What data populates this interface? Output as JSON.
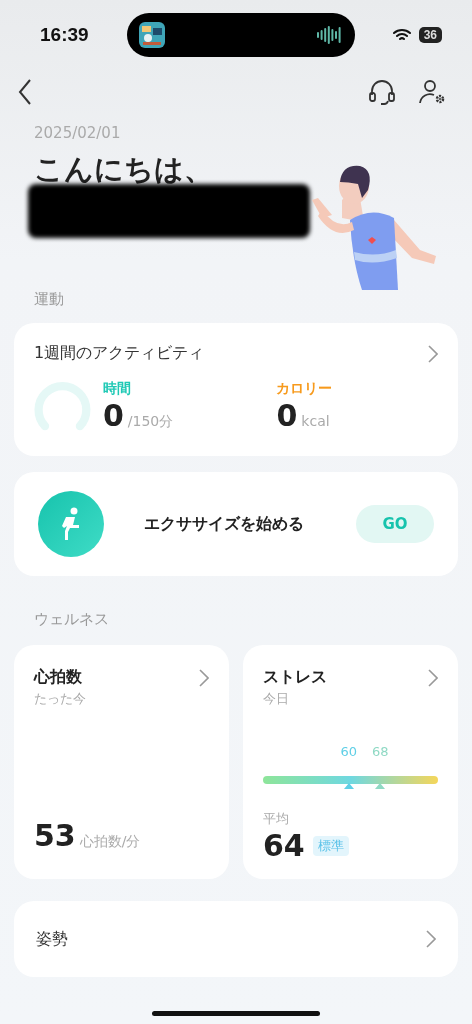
{
  "status_bar": {
    "time": "16:39",
    "battery": "36"
  },
  "header": {
    "date": "2025/02/01",
    "greeting": "こんにちは、"
  },
  "sections": [
    {
      "title": "運動"
    },
    {
      "title": "ウェルネス"
    }
  ],
  "activity": {
    "title": "1週間のアクティビティ",
    "metrics": [
      {
        "label": "時間",
        "value": "0",
        "unit": "/150分",
        "color": "#1fc9b5"
      },
      {
        "label": "カロリー",
        "value": "0",
        "unit": "kcal",
        "color": "#f79a1c"
      }
    ]
  },
  "exercise": {
    "label": "エクササイズを始める",
    "button": "GO"
  },
  "heart": {
    "title": "心拍数",
    "subtitle": "たった今",
    "value": "53",
    "unit": "心拍数/分"
  },
  "stress": {
    "title": "ストレス",
    "subtitle": "今日",
    "markers": [
      {
        "label": "60",
        "level": 0.49,
        "color": "#5fcfe6"
      },
      {
        "label": "68",
        "level": 0.67,
        "color": "#8fd9c4"
      }
    ],
    "average_label": "平均",
    "value": "64",
    "badge": "標準"
  },
  "posture": {
    "title": "姿勢"
  }
}
